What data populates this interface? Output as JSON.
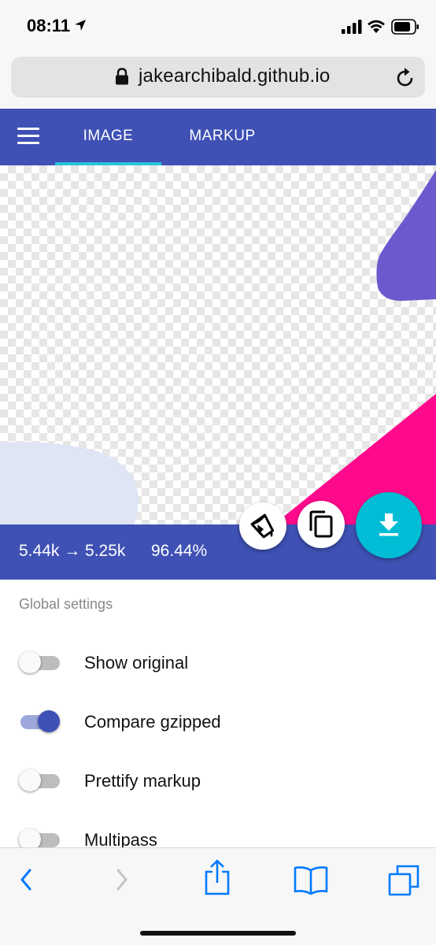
{
  "status_bar": {
    "time": "08:11",
    "icons": [
      "location-arrow-icon",
      "signal-icon",
      "wifi-icon",
      "battery-icon"
    ]
  },
  "browser": {
    "url": "jakearchibald.github.io",
    "icons": [
      "lock-icon",
      "reload-icon"
    ]
  },
  "app_bar": {
    "tabs": [
      {
        "label": "IMAGE",
        "active": true
      },
      {
        "label": "MARKUP",
        "active": false
      }
    ],
    "accent_color": "#3f51b5",
    "indicator_color": "#26c6da"
  },
  "results": {
    "size_change": "5.44k → 5.25k",
    "percentage": "96.44%",
    "buttons": [
      "paint-bucket-icon",
      "copy-icon",
      "download-icon"
    ]
  },
  "settings": {
    "section_title": "Global settings",
    "items": [
      {
        "label": "Show original",
        "enabled": false
      },
      {
        "label": "Compare gzipped",
        "enabled": true
      },
      {
        "label": "Prettify markup",
        "enabled": false
      },
      {
        "label": "Multipass",
        "enabled": false
      }
    ]
  },
  "toolbar": {
    "icons": [
      "back-icon",
      "forward-icon",
      "share-icon",
      "bookmarks-icon",
      "tabs-icon"
    ]
  },
  "colors": {
    "shape_purple": "#6a5acd",
    "shape_pink": "#ff0a8c",
    "shape_light": "#dfe5f5",
    "download_teal": "#00bcd4"
  }
}
